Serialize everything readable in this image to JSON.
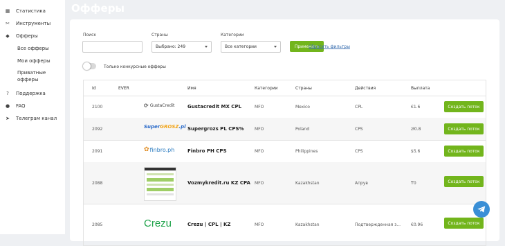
{
  "page_title": "Офферы",
  "sidebar": {
    "statistics": "Статистика",
    "tools": "Инструменты",
    "offers": "Офферы",
    "sub": {
      "all": "Все офферы",
      "mine": "Мои офферы",
      "private": "Приватные офферы"
    },
    "support": "Поддержка",
    "faq": "FAQ",
    "telegram": "Телеграм канал"
  },
  "filters": {
    "search_label": "Поиск",
    "search_value": "",
    "countries_label": "Страны",
    "countries_value": "Выбрано: 249",
    "categories_label": "Категории",
    "categories_value": "Все категории",
    "apply_label": "Применить",
    "reset_label": "Сбросить фильтры",
    "toggle_label": "Только конкурсные офферы"
  },
  "table": {
    "headers": [
      "Id",
      "EVER",
      "Имя",
      "Категории",
      "Страны",
      "Действия",
      "Выплата"
    ],
    "button_label": "Создать поток",
    "rows": [
      {
        "id": "2100",
        "name": "Gustacredit MX CPL",
        "category": "MFO",
        "country": "Mexico",
        "action": "CPL",
        "payout": "€1.6",
        "logo": "gustacredit"
      },
      {
        "id": "2092",
        "name": "Supergrozs PL CPS%",
        "category": "MFO",
        "country": "Poland",
        "action": "CPS",
        "payout": "zł0.8",
        "logo": "supergrosz"
      },
      {
        "id": "2091",
        "name": "Finbro PH CPS",
        "category": "MFO",
        "country": "Philippines",
        "action": "CPS",
        "payout": "$5.6",
        "logo": "finbro"
      },
      {
        "id": "2088",
        "name": "Vozmykredit.ru KZ CPA",
        "category": "MFO",
        "country": "Kazakhstan",
        "action": "Апрув",
        "payout": "₸0",
        "logo": "vozmykredit"
      },
      {
        "id": "2085",
        "name": "Crezu | CPL | KZ",
        "category": "MFO",
        "country": "Kazakhstan",
        "action": "Подтвержденная з...",
        "payout": "€0.96",
        "logo": "crezu"
      }
    ]
  },
  "logos": {
    "gustacredit": "GustaCredit",
    "supergrosz_a": "Super",
    "supergrosz_b": "GROSZ",
    "supergrosz_c": ".pl",
    "finbro": "finbro.ph",
    "crezu": "Crezu"
  },
  "colors": {
    "accent": "#72b51c",
    "link": "#3a6fb0",
    "telegram": "#3a8fd6"
  }
}
